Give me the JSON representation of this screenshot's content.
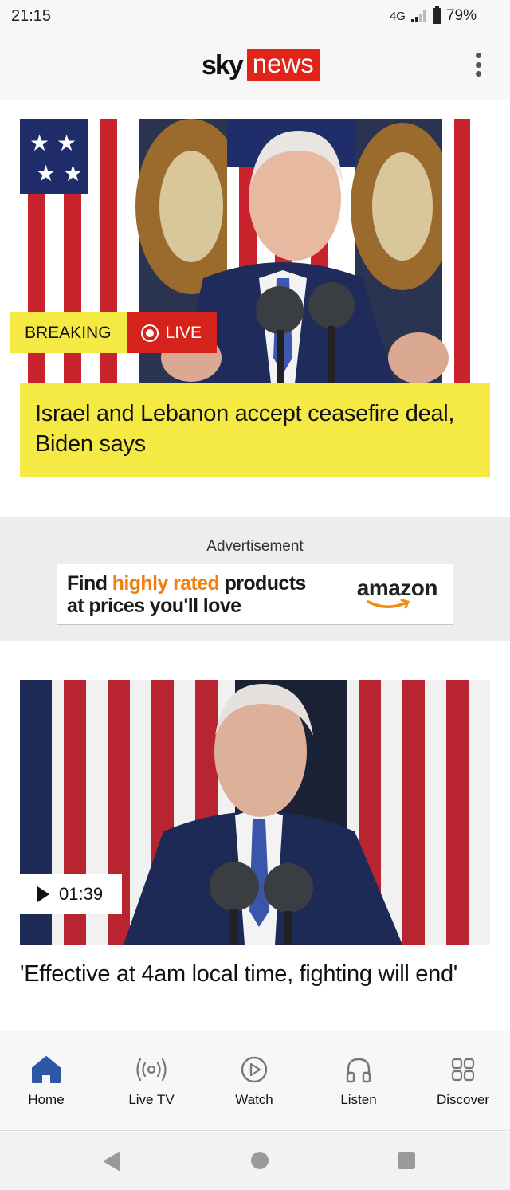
{
  "status_bar": {
    "time": "21:15",
    "network": "4G",
    "battery": "79%"
  },
  "header": {
    "logo_sky": "sky",
    "logo_news": "news",
    "menu_icon": "more-vertical-icon"
  },
  "articles": [
    {
      "badge_breaking": "BREAKING",
      "badge_live": "LIVE",
      "headline": "Israel and Lebanon accept ceasefire deal, Biden says"
    },
    {
      "duration": "01:39",
      "headline": "'Effective at 4am local time, fighting will end'"
    }
  ],
  "advertisement": {
    "label": "Advertisement",
    "text_find": "Find",
    "text_highlight": "highly rated",
    "text_products": "products",
    "text_line2": "at prices you'll love",
    "brand": "amazon"
  },
  "bottom_nav": {
    "items": [
      {
        "label": "Home",
        "icon": "home-icon",
        "active": true
      },
      {
        "label": "Live TV",
        "icon": "broadcast-icon",
        "active": false
      },
      {
        "label": "Watch",
        "icon": "play-circle-icon",
        "active": false
      },
      {
        "label": "Listen",
        "icon": "headphones-icon",
        "active": false
      },
      {
        "label": "Discover",
        "icon": "grid-icon",
        "active": false
      }
    ]
  },
  "colors": {
    "brand_red": "#e2231a",
    "breaking_yellow": "#f5e944",
    "live_red": "#d5221a",
    "nav_active": "#2d57a6",
    "ad_orange": "#f07f0d"
  }
}
